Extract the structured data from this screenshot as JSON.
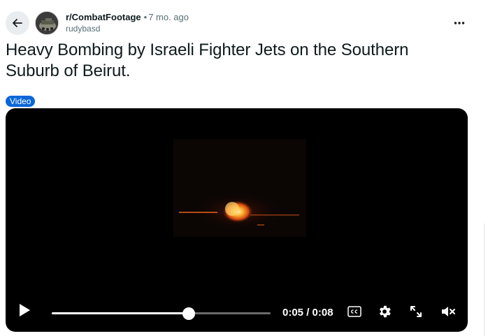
{
  "post": {
    "subreddit": "r/CombatFootage",
    "separator": "•",
    "time": "7 mo. ago",
    "author": "rudybasd",
    "title": "Heavy Bombing by Israeli Fighter Jets on the Southern Suburb of Beirut.",
    "flair": "Video"
  },
  "player": {
    "current_time": "0:05",
    "duration": "0:08",
    "time_display": "0:05 / 0:08",
    "progress_fraction": 0.625,
    "state": "paused",
    "muted": true
  },
  "icons": {
    "back": "arrow-left-icon",
    "more": "more-horizontal-icon",
    "play": "play-icon",
    "cc": "closed-captions-icon",
    "settings": "gear-icon",
    "fullscreen": "expand-icon",
    "mute": "volume-muted-icon"
  },
  "colors": {
    "flair_bg": "#0a66d9",
    "video_bg": "#000000",
    "meta_text": "#576f76"
  }
}
